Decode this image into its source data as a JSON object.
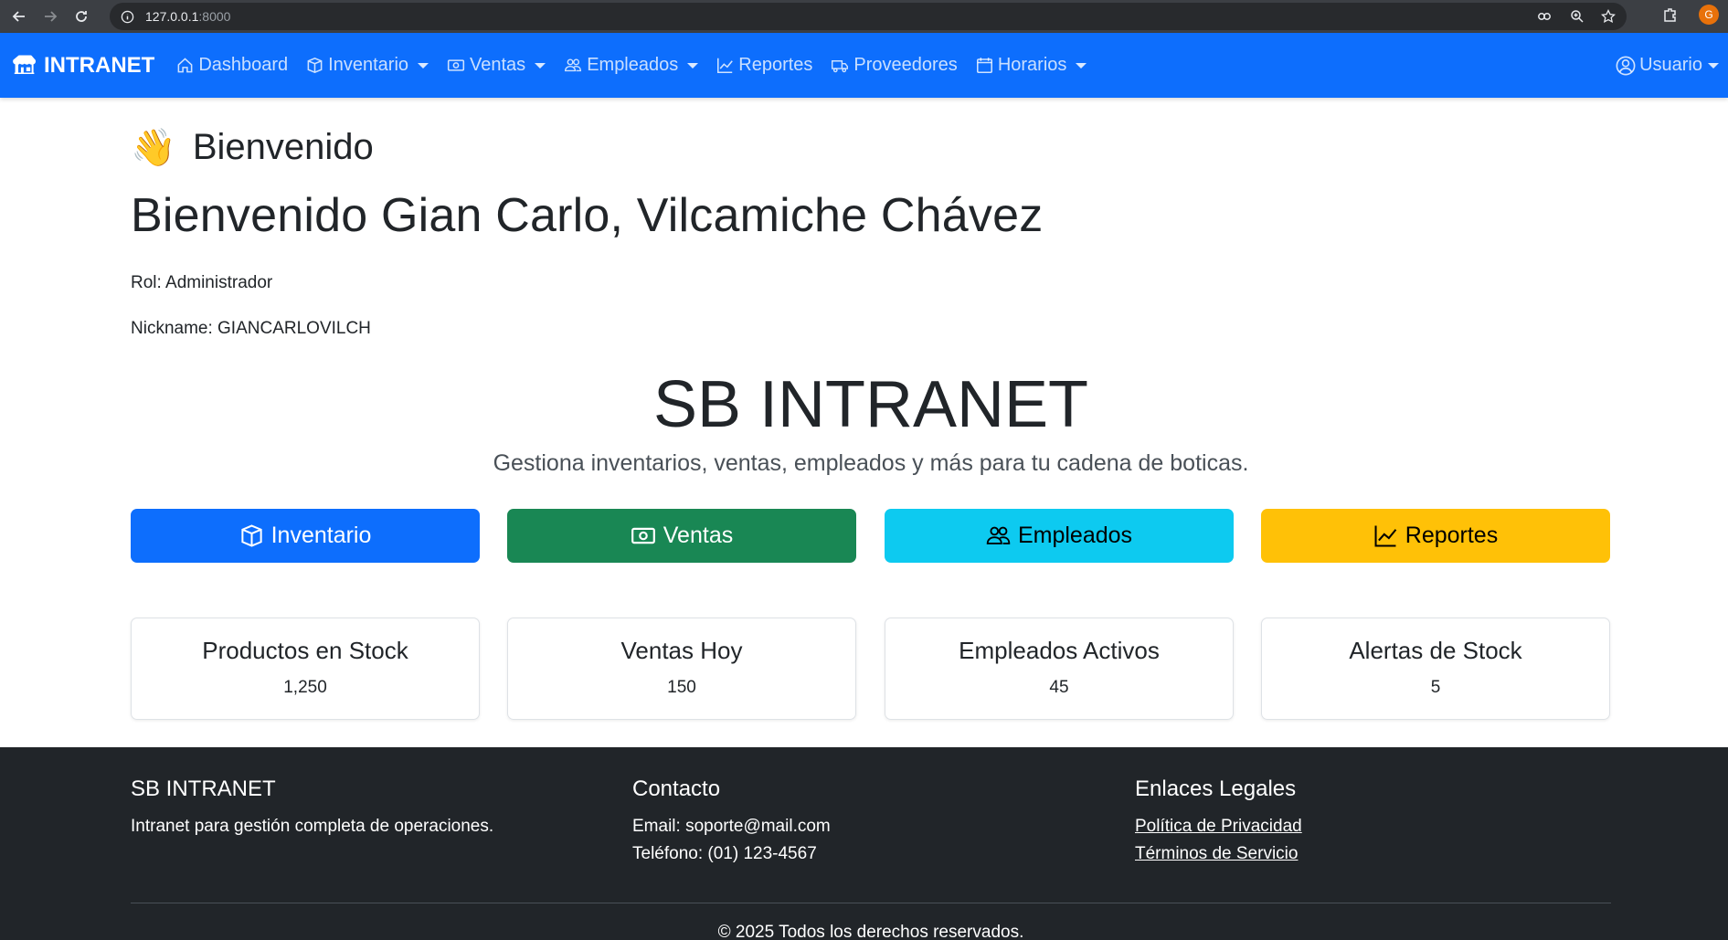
{
  "browser": {
    "url_host": "127.0.0.1",
    "url_port": ":8000",
    "profile_initial": "G"
  },
  "navbar": {
    "brand": "INTRANET",
    "items": [
      {
        "label": "Dashboard",
        "icon": "house-icon",
        "dropdown": false
      },
      {
        "label": "Inventario",
        "icon": "box-icon",
        "dropdown": true
      },
      {
        "label": "Ventas",
        "icon": "cash-icon",
        "dropdown": true
      },
      {
        "label": "Empleados",
        "icon": "people-icon",
        "dropdown": true
      },
      {
        "label": "Reportes",
        "icon": "graph-icon",
        "dropdown": false
      },
      {
        "label": "Proveedores",
        "icon": "truck-icon",
        "dropdown": false
      },
      {
        "label": "Horarios",
        "icon": "calendar-icon",
        "dropdown": true
      }
    ],
    "user_label": "Usuario"
  },
  "welcome": {
    "emoji": "👋",
    "heading": "Bienvenido",
    "full_greeting": "Bienvenido Gian Carlo, Vilcamiche Chávez",
    "role_line": "Rol: Administrador",
    "nickname_line": "Nickname: GIANCARLOVILCH"
  },
  "hero": {
    "title": "SB INTRANET",
    "subtitle": "Gestiona inventarios, ventas, empleados y más para tu cadena de boticas."
  },
  "actions": [
    {
      "label": "Inventario",
      "icon": "box-icon",
      "color": "#0d6efd"
    },
    {
      "label": "Ventas",
      "icon": "cash-icon",
      "color": "#198754"
    },
    {
      "label": "Empleados",
      "icon": "people-icon",
      "color": "#0dcaf0"
    },
    {
      "label": "Reportes",
      "icon": "graph-icon",
      "color": "#ffc107"
    }
  ],
  "stats": [
    {
      "title": "Productos en Stock",
      "value": "1,250"
    },
    {
      "title": "Ventas Hoy",
      "value": "150"
    },
    {
      "title": "Empleados Activos",
      "value": "45"
    },
    {
      "title": "Alertas de Stock",
      "value": "5"
    }
  ],
  "footer": {
    "about_title": "SB INTRANET",
    "about_text": "Intranet para gestión completa de operaciones.",
    "contact_title": "Contacto",
    "contact_email": "Email: soporte@mail.com",
    "contact_phone": "Teléfono: (01) 123-4567",
    "legal_title": "Enlaces Legales",
    "privacy_link": "Política de Privacidad",
    "terms_link": "Términos de Servicio",
    "copyright": "© 2025 Todos los derechos reservados."
  }
}
